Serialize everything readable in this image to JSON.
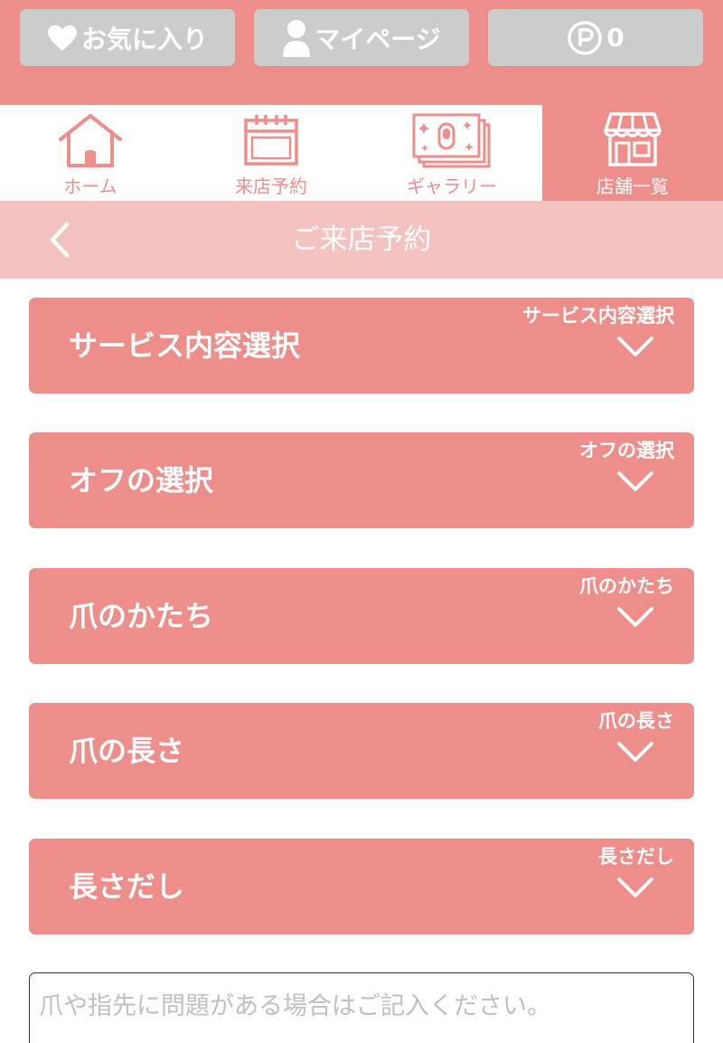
{
  "top_buttons": {
    "favorites": "お気に入り",
    "mypage": "マイページ",
    "points": "0"
  },
  "nav": {
    "tabs": [
      {
        "label": "ホーム",
        "icon": "house-icon",
        "active": false
      },
      {
        "label": "来店予約",
        "icon": "calendar-icon",
        "active": false
      },
      {
        "label": "ギャラリー",
        "icon": "gallery-icon",
        "active": false
      },
      {
        "label": "店舗一覧",
        "icon": "store-icon",
        "active": true
      }
    ]
  },
  "subheader": {
    "title": "ご来店予約"
  },
  "accordions": [
    {
      "title": "サービス内容選択",
      "caption": "サービス内容選択"
    },
    {
      "title": "オフの選択",
      "caption": "オフの選択"
    },
    {
      "title": "爪のかたち",
      "caption": "爪のかたち"
    },
    {
      "title": "爪の長さ",
      "caption": "爪の長さ"
    },
    {
      "title": "長さだし",
      "caption": "長さだし"
    }
  ],
  "note": {
    "placeholder": "爪や指先に問題がある場合はご記入ください。"
  },
  "colors": {
    "primary": "#ee8e8b",
    "light": "#f4c2c1",
    "button_gray": "#cccccc"
  }
}
